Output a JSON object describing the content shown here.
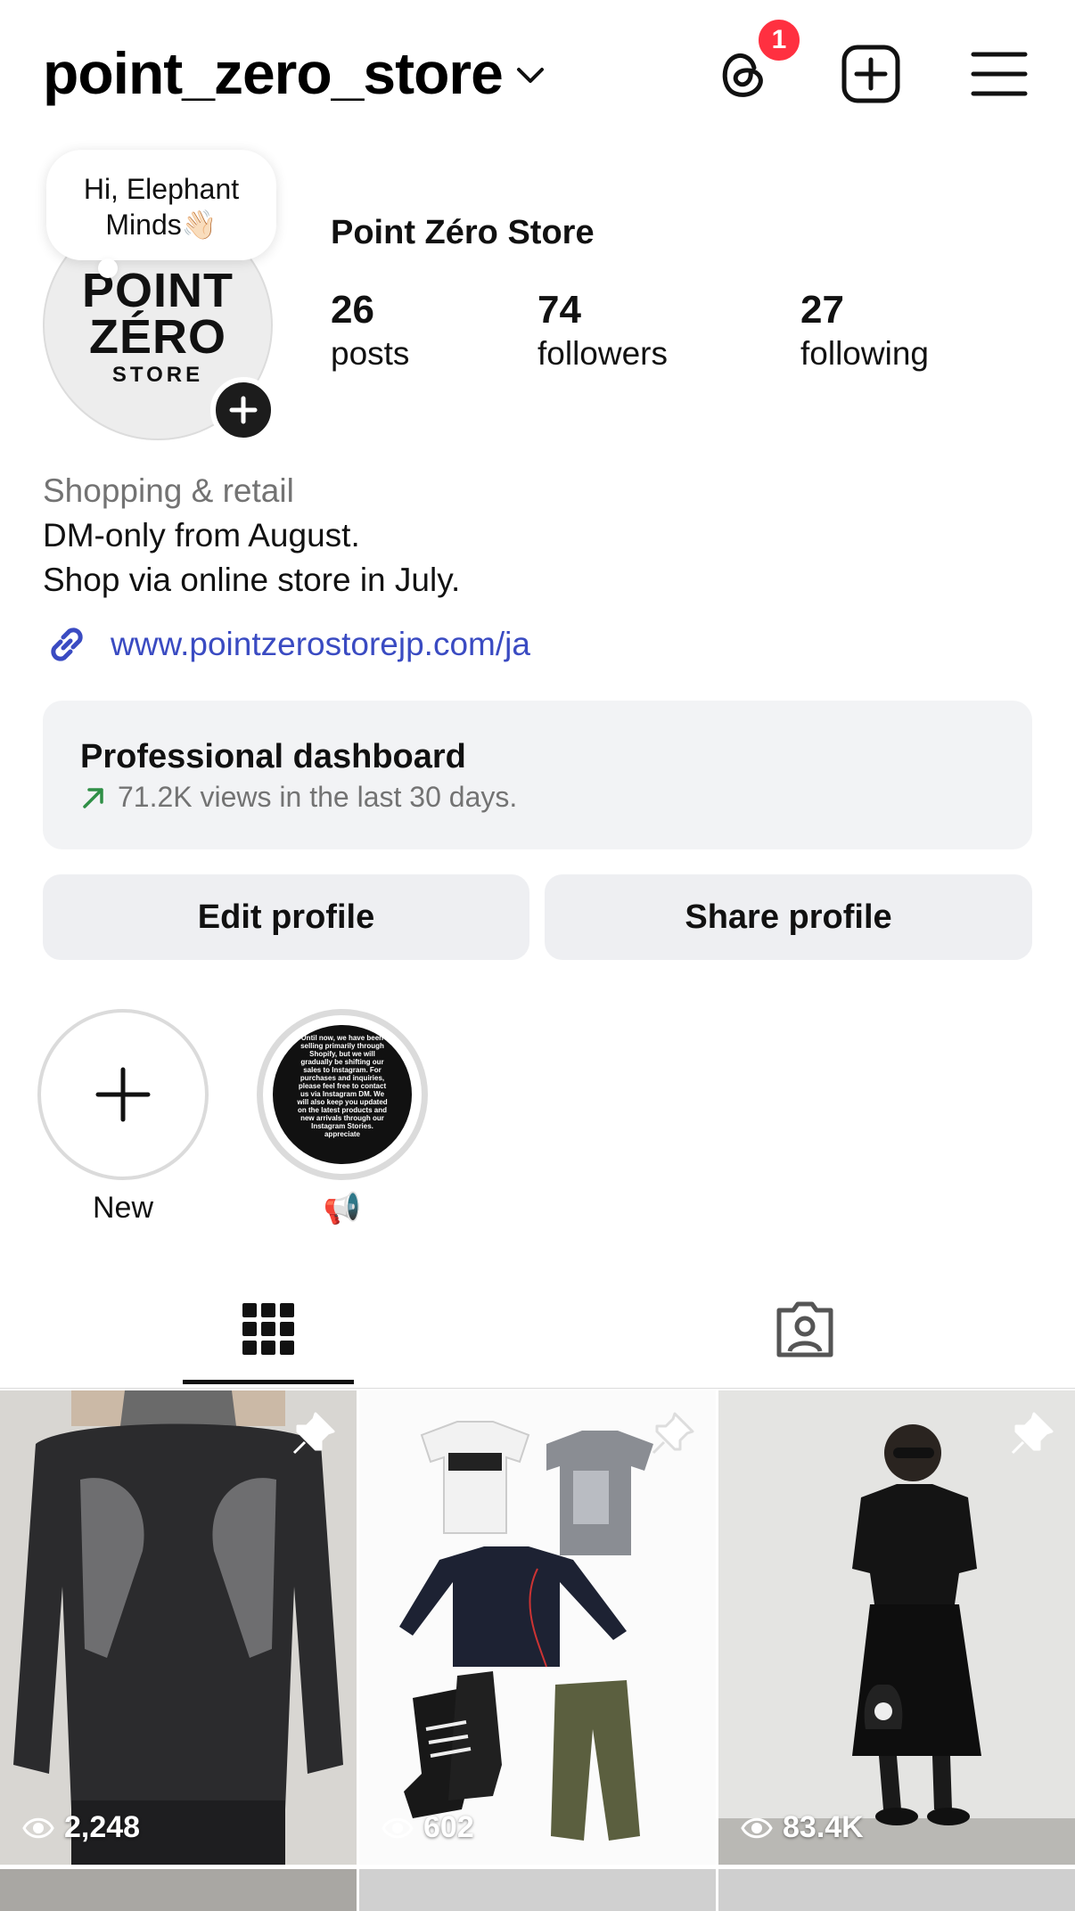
{
  "header": {
    "username": "point_zero_store",
    "notification_count": "1"
  },
  "profile": {
    "note": "Hi, Elephant Minds👋🏻",
    "avatar_logo": {
      "line1": "POINT",
      "line2": "ZÉRO",
      "line3": "STORE"
    },
    "display_name": "Point Zéro Store",
    "stats": [
      {
        "value": "26",
        "label": "posts"
      },
      {
        "value": "74",
        "label": "followers"
      },
      {
        "value": "27",
        "label": "following"
      }
    ],
    "category": "Shopping & retail",
    "bio_lines": [
      "DM-only from August.",
      "Shop via online store in July."
    ],
    "link": "www.pointzerostorejp.com/ja"
  },
  "dashboard": {
    "title": "Professional dashboard",
    "subtitle": "71.2K views in the last 30 days."
  },
  "buttons": {
    "edit": "Edit profile",
    "share": "Share profile"
  },
  "highlights": [
    {
      "label": "New"
    },
    {
      "label": "📢",
      "cover_text": "Until now, we have been selling primarily through Shopify, but we will gradually be shifting our sales to Instagram. For purchases and inquiries, please feel free to contact us via Instagram DM. We will also keep you updated on the latest products and new arrivals through our Instagram Stories. appreciate"
    }
  ],
  "tabs": [
    "grid",
    "tagged"
  ],
  "posts": [
    {
      "views": "2,248",
      "pinned": true
    },
    {
      "views": "602",
      "pinned": true
    },
    {
      "views": "83.4K",
      "pinned": true
    }
  ],
  "colors": {
    "link": "#3a4bc2",
    "badge": "#ff3040",
    "trend_arrow": "#2f8f46",
    "muted": "#737373"
  }
}
